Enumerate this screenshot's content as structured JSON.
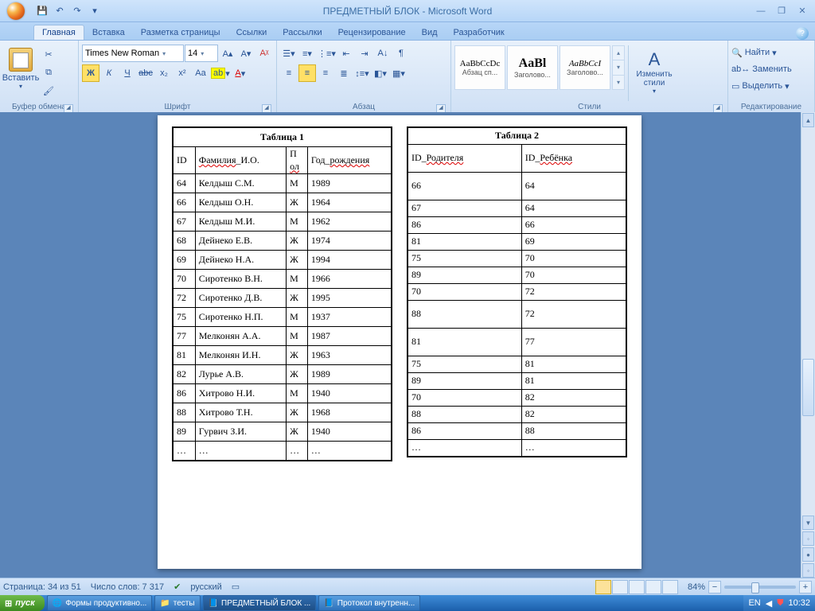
{
  "app": {
    "title": "ПРЕДМЕТНЫЙ БЛОК - Microsoft Word"
  },
  "qat": {
    "save": "💾",
    "undo": "↶",
    "redo": "↷",
    "more": "▾"
  },
  "win": {
    "min": "—",
    "max": "❐",
    "close": "✕"
  },
  "tabs": [
    "Главная",
    "Вставка",
    "Разметка страницы",
    "Ссылки",
    "Рассылки",
    "Рецензирование",
    "Вид",
    "Разработчик"
  ],
  "active_tab": 0,
  "ribbon": {
    "clipboard": {
      "paste": "Вставить",
      "label": "Буфер обмена"
    },
    "font": {
      "label": "Шрифт",
      "family": "Times New Roman",
      "size": "14",
      "row2": [
        "Ж",
        "К",
        "Ч",
        "abc",
        "x₂",
        "x²",
        "Aa",
        "ab",
        "A"
      ]
    },
    "para": {
      "label": "Абзац"
    },
    "styles": {
      "label": "Стили",
      "items": [
        {
          "prev": "AaBbCcDc",
          "name": "Абзац сп..."
        },
        {
          "prev": "AaBl",
          "name": "Заголово..."
        },
        {
          "prev": "AaBbCcI",
          "name": "Заголово..."
        }
      ],
      "change": "Изменить стили"
    },
    "edit": {
      "label": "Редактирование",
      "find": "Найти",
      "replace": "Заменить",
      "select": "Выделить"
    }
  },
  "doc": {
    "t1": {
      "title": "Таблица 1",
      "headers": [
        "ID",
        "Фамилия_И.О.",
        "Пол",
        "Год_рождения"
      ],
      "rows": [
        [
          "64",
          "Келдыш С.М.",
          "М",
          "1989"
        ],
        [
          "66",
          "Келдыш О.Н.",
          "Ж",
          "1964"
        ],
        [
          "67",
          "Келдыш М.И.",
          "М",
          "1962"
        ],
        [
          "68",
          "Дейнеко Е.В.",
          "Ж",
          "1974"
        ],
        [
          "69",
          "Дейнеко Н.А.",
          "Ж",
          "1994"
        ],
        [
          "70",
          "Сиротенко В.Н.",
          "М",
          "1966"
        ],
        [
          "72",
          "Сиротенко Д.В.",
          "Ж",
          "1995"
        ],
        [
          "75",
          "Сиротенко Н.П.",
          "М",
          "1937"
        ],
        [
          "77",
          "Мелконян А.А.",
          "М",
          "1987"
        ],
        [
          "81",
          "Мелконян И.Н.",
          "Ж",
          "1963"
        ],
        [
          "82",
          "Лурье А.В.",
          "Ж",
          "1989"
        ],
        [
          "86",
          "Хитрово Н.И.",
          "М",
          "1940"
        ],
        [
          "88",
          "Хитрово Т.Н.",
          "Ж",
          "1968"
        ],
        [
          "89",
          "Гурвич З.И.",
          "Ж",
          "1940"
        ],
        [
          "…",
          "…",
          "…",
          "…"
        ]
      ]
    },
    "t2": {
      "title": "Таблица 2",
      "headers": [
        "ID_Родителя",
        "ID_Ребёнка"
      ],
      "rows": [
        {
          "c": [
            "66",
            "64"
          ],
          "tall": true
        },
        {
          "c": [
            "67",
            "64"
          ]
        },
        {
          "c": [
            "86",
            "66"
          ]
        },
        {
          "c": [
            "81",
            "69"
          ]
        },
        {
          "c": [
            "75",
            "70"
          ]
        },
        {
          "c": [
            "89",
            "70"
          ]
        },
        {
          "c": [
            "70",
            "72"
          ]
        },
        {
          "c": [
            "88",
            "72"
          ],
          "tall": true
        },
        {
          "c": [
            "81",
            "77"
          ],
          "tall": true
        },
        {
          "c": [
            "75",
            "81"
          ]
        },
        {
          "c": [
            "89",
            "81"
          ]
        },
        {
          "c": [
            "70",
            "82"
          ]
        },
        {
          "c": [
            "88",
            "82"
          ]
        },
        {
          "c": [
            "86",
            "88"
          ]
        },
        {
          "c": [
            "…",
            "…"
          ]
        }
      ]
    }
  },
  "status": {
    "page": "Страница: 34 из 51",
    "words": "Число слов: 7 317",
    "lang": "русский",
    "zoom": "84%"
  },
  "taskbar": {
    "start": "пуск",
    "items": [
      "Формы продуктивно...",
      "тесты",
      "ПРЕДМЕТНЫЙ БЛОК ...",
      "Протокол внутренн..."
    ],
    "active": 2,
    "lang": "EN",
    "time": "10:32"
  }
}
